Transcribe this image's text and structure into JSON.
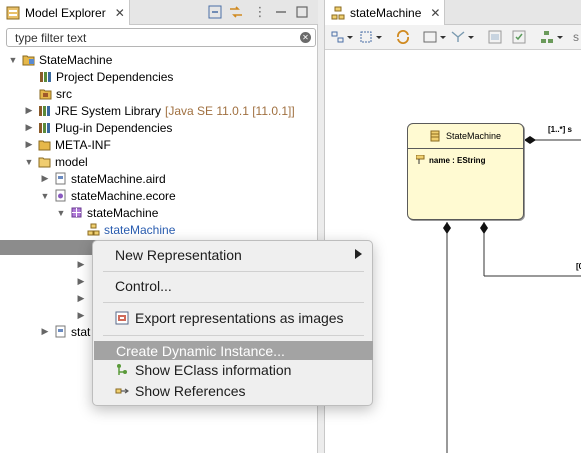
{
  "model_explorer": {
    "tab_title": "Model Explorer",
    "filter_placeholder": "type filter text",
    "tree": [
      {
        "label": "StateMachine",
        "icon": "project-icon"
      },
      {
        "label": "Project Dependencies",
        "icon": "library-icon"
      },
      {
        "label": "src",
        "icon": "package-folder-icon"
      },
      {
        "label": "JRE System Library",
        "decoration": "[Java SE 11.0.1 [11.0.1]]",
        "icon": "library-icon"
      },
      {
        "label": "Plug-in Dependencies",
        "icon": "library-icon"
      },
      {
        "label": "META-INF",
        "icon": "folder-icon"
      },
      {
        "label": "model",
        "icon": "folder-icon"
      },
      {
        "label": "stateMachine.aird",
        "icon": "aird-file-icon"
      },
      {
        "label": "stateMachine.ecore",
        "icon": "ecore-file-icon"
      },
      {
        "label": "stateMachine",
        "icon": "epackage-icon"
      },
      {
        "label": "stateMachine",
        "icon": "diagram-icon"
      },
      {
        "label": "stat",
        "icon": "project-icon"
      }
    ]
  },
  "editor": {
    "tab_title": "stateMachine",
    "toolbar_tail": "s",
    "node": {
      "title": "StateMachine",
      "attribute": "name : EString"
    },
    "edge_labels": {
      "top_right": "[1..*] s",
      "mid_right": "[0"
    }
  },
  "context_menu": {
    "items": [
      {
        "label": "New Representation",
        "has_submenu": true
      },
      {
        "label": "Control..."
      },
      {
        "label": "Export representations as images",
        "icon": "export-image-icon"
      },
      {
        "label": "Create Dynamic Instance...",
        "selected": true
      },
      {
        "label": "Show EClass information",
        "icon": "eclass-info-icon"
      },
      {
        "label": "Show References",
        "icon": "references-icon"
      }
    ]
  },
  "colors": {
    "selection_row": "#8c8c8c",
    "menu_selected": "#a3a3a3",
    "node_fill": "#fffad2",
    "decoration_text": "#a07040",
    "link_text": "#2a5db0"
  }
}
